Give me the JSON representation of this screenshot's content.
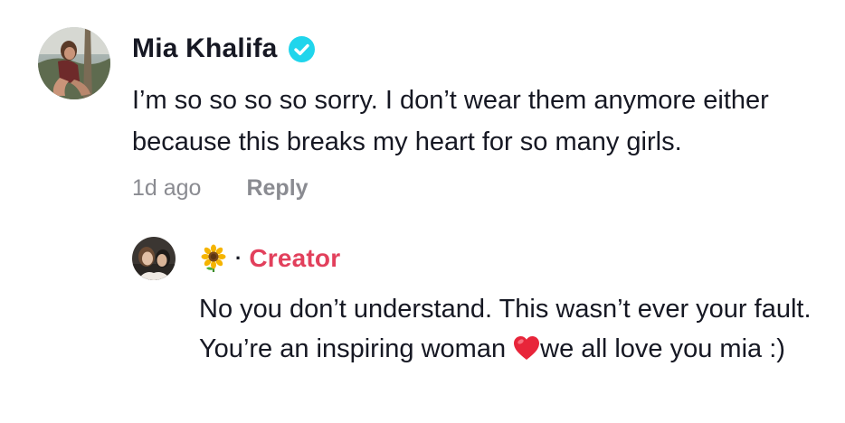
{
  "main_comment": {
    "author": "Mia Khalifa",
    "verified": true,
    "text": "I’m so so so so sorry. I don’t wear them anymore either because this breaks my heart for so many girls.",
    "time": "1d ago",
    "reply_label": "Reply"
  },
  "reply_comment": {
    "name_emoji": "sunflower-icon",
    "separator": "·",
    "badge": "Creator",
    "text_before_heart": "No you don’t understand. This wasn’t ever your fault. You’re an inspiring woman ",
    "heart_emoji": "heart-icon",
    "text_after_heart": "we all love you mia :)"
  },
  "colors": {
    "text": "#161823",
    "meta": "#8a8b91",
    "creator": "#e2405c",
    "verified": "#20d5ec"
  }
}
